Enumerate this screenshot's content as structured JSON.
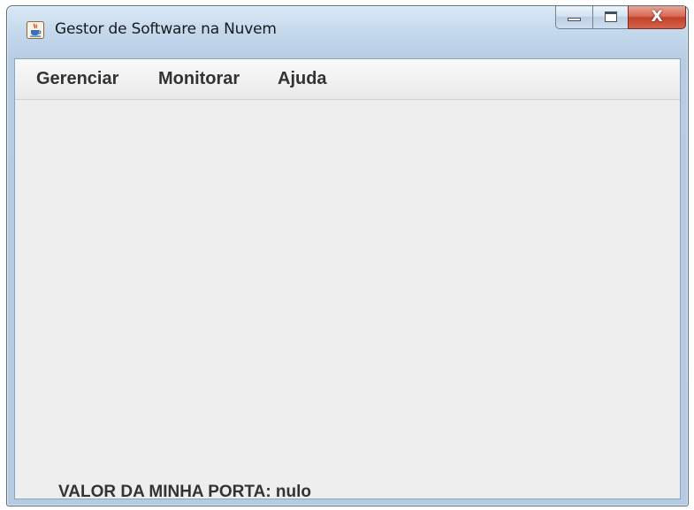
{
  "window": {
    "title": "Gestor de Software na Nuvem",
    "icon": "java-cup-icon",
    "controls": {
      "minimize_icon": "minimize-icon",
      "maximize_icon": "maximize-icon",
      "close_symbol": "X"
    }
  },
  "menubar": {
    "items": [
      {
        "label": "Gerenciar"
      },
      {
        "label": "Monitorar"
      },
      {
        "label": "Ajuda"
      }
    ]
  },
  "content": {
    "port_label": "VALOR DA MINHA PORTA: nulo"
  },
  "colors": {
    "frame": "#b7cde3",
    "client_background": "#eeeeee",
    "text": "#333333",
    "close_button": "#c2412a"
  }
}
